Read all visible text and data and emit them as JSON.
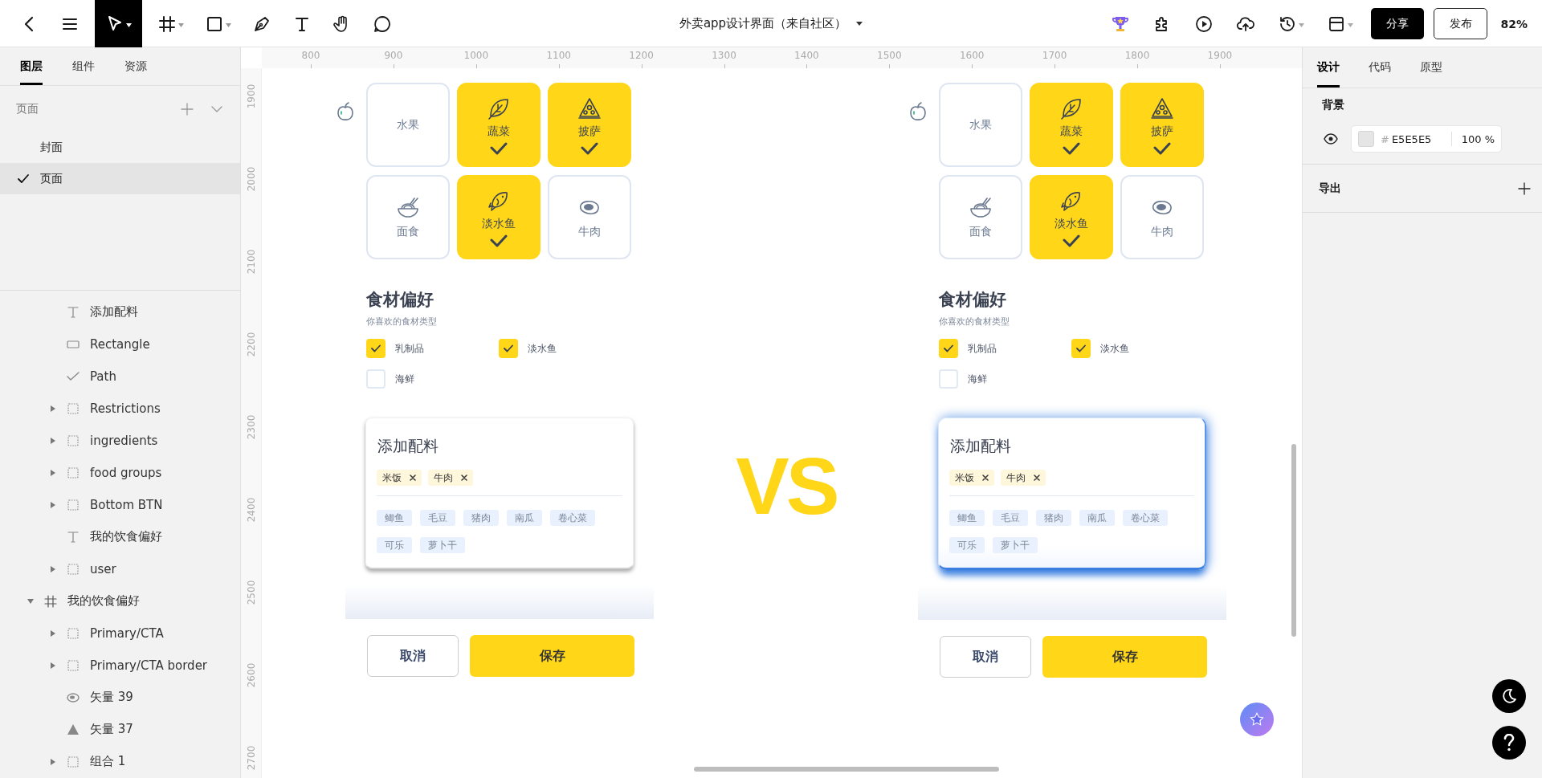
{
  "toolbar": {
    "tools": [
      {
        "kind": "back",
        "selected": false
      },
      {
        "kind": "menu",
        "selected": false
      },
      {
        "kind": "move",
        "selected": true
      },
      {
        "kind": "frame",
        "selected": false
      },
      {
        "kind": "rect",
        "selected": false
      },
      {
        "kind": "pen",
        "selected": false
      },
      {
        "kind": "text",
        "selected": false
      },
      {
        "kind": "hand",
        "selected": false
      },
      {
        "kind": "comment",
        "selected": false
      }
    ],
    "title": "外卖app设计界面（来自社区）",
    "actions": [
      {
        "kind": "trophy"
      },
      {
        "kind": "plugin"
      },
      {
        "kind": "play"
      },
      {
        "kind": "upload"
      },
      {
        "kind": "history"
      },
      {
        "kind": "layout"
      }
    ],
    "share": "分享",
    "publish": "发布",
    "zoom": "82%"
  },
  "left_panel": {
    "tabs": [
      {
        "label": "图层",
        "selected": true
      },
      {
        "label": "组件",
        "selected": false
      },
      {
        "label": "资源",
        "selected": false
      }
    ],
    "pages_header": "页面",
    "pages": [
      {
        "label": "封面",
        "selected": false
      },
      {
        "label": "页面",
        "selected": true
      }
    ],
    "layers": [
      {
        "kind": "continued",
        "children": [
          {
            "kind": "text",
            "name": "添加配料"
          },
          {
            "kind": "rect",
            "name": "Rectangle"
          },
          {
            "kind": "path",
            "name": "Path"
          },
          {
            "kind": "group",
            "name": "Restrictions",
            "expanded": false
          },
          {
            "kind": "group",
            "name": "ingredients",
            "expanded": false
          },
          {
            "kind": "group",
            "name": "food groups",
            "expanded": false
          },
          {
            "kind": "group",
            "name": "Bottom BTN",
            "expanded": false
          },
          {
            "kind": "text",
            "name": "我的饮食偏好"
          },
          {
            "kind": "group",
            "name": "user",
            "expanded": false
          }
        ]
      },
      {
        "kind": "frame",
        "name": "我的饮食偏好",
        "expanded": true,
        "children": [
          {
            "kind": "group",
            "name": "Primary/CTA",
            "expanded": false
          },
          {
            "kind": "group",
            "name": "Primary/CTA border",
            "expanded": false
          },
          {
            "kind": "oval",
            "name": "矢量 39"
          },
          {
            "kind": "triangle",
            "name": "矢量 37"
          },
          {
            "kind": "group",
            "name": "组合 1",
            "expanded": false
          }
        ]
      }
    ]
  },
  "rulers": {
    "horizontal": [
      "800",
      "900",
      "1000",
      "1100",
      "1200",
      "1300",
      "1400",
      "1500",
      "1600",
      "1700",
      "1800",
      "1900"
    ],
    "vertical": [
      "1900",
      "2000",
      "2100",
      "2200",
      "2300",
      "2400",
      "2500",
      "2600",
      "2700"
    ]
  },
  "mockups": [
    {
      "highlighted": false,
      "tiles": [
        {
          "label": "水果",
          "selected": false
        },
        {
          "label": "蔬菜",
          "kind": "leaf",
          "selected": true
        },
        {
          "label": "披萨",
          "kind": "pizza",
          "selected": true
        },
        {
          "label": "面食",
          "kind": "noodles",
          "selected": false
        },
        {
          "label": "淡水鱼",
          "kind": "fish",
          "selected": true
        },
        {
          "label": "牛肉",
          "kind": "steak",
          "selected": false
        }
      ],
      "title": "食材偏好",
      "subtitle": "你喜欢的食材类型",
      "options": [
        {
          "label": "乳制品",
          "checked": true
        },
        {
          "label": "淡水鱼",
          "checked": true
        },
        {
          "label": "海鲜",
          "checked": false
        }
      ],
      "card": {
        "title": "添加配料",
        "chosen": [
          "米饭",
          "牛肉"
        ],
        "suggestions": [
          "鲫鱼",
          "毛豆",
          "猪肉",
          "南瓜",
          "卷心菜",
          "可乐",
          "萝卜干"
        ]
      },
      "cancel": "取消",
      "save": "保存"
    },
    {
      "highlighted": true,
      "tiles": [
        {
          "label": "水果",
          "selected": false
        },
        {
          "label": "蔬菜",
          "kind": "leaf",
          "selected": true
        },
        {
          "label": "披萨",
          "kind": "pizza",
          "selected": true
        },
        {
          "label": "面食",
          "kind": "noodles",
          "selected": false
        },
        {
          "label": "淡水鱼",
          "kind": "fish",
          "selected": true
        },
        {
          "label": "牛肉",
          "kind": "steak",
          "selected": false
        }
      ],
      "title": "食材偏好",
      "subtitle": "你喜欢的食材类型",
      "options": [
        {
          "label": "乳制品",
          "checked": true
        },
        {
          "label": "淡水鱼",
          "checked": true
        },
        {
          "label": "海鲜",
          "checked": false
        }
      ],
      "card": {
        "title": "添加配料",
        "chosen": [
          "米饭",
          "牛肉"
        ],
        "suggestions": [
          "鲫鱼",
          "毛豆",
          "猪肉",
          "南瓜",
          "卷心菜",
          "可乐",
          "萝卜干"
        ]
      },
      "cancel": "取消",
      "save": "保存"
    }
  ],
  "vs": "VS",
  "right_panel": {
    "tabs": [
      {
        "label": "设计",
        "selected": true
      },
      {
        "label": "代码",
        "selected": false
      },
      {
        "label": "原型",
        "selected": false
      }
    ],
    "background": {
      "title": "背景",
      "visible": true,
      "hash": "#",
      "hex": "E5E5E5",
      "opacity": "100 %"
    },
    "export": "导出"
  }
}
